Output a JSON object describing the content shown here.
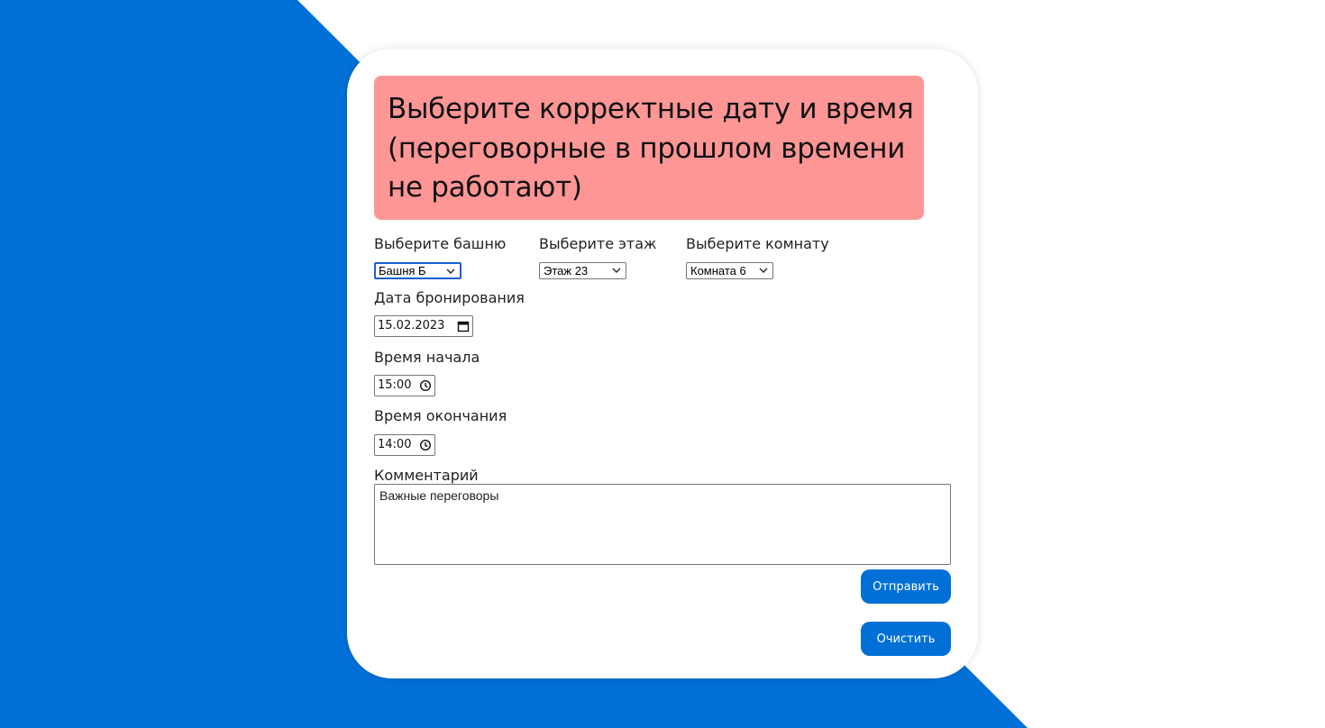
{
  "colors": {
    "accent": "#0170d6",
    "error_bg": "#ff9696",
    "background_shape": "#0170d6"
  },
  "error": {
    "message": "Выберите корректные дату и время (переговорные в прошлом времени не работают)"
  },
  "tower": {
    "label": "Выберите башню",
    "value": "Башня Б"
  },
  "floor": {
    "label": "Выберите этаж",
    "value": "Этаж 23"
  },
  "room": {
    "label": "Выберите комнату",
    "value": "Комната 6"
  },
  "date": {
    "label": "Дата бронирования",
    "value": "15.02.2023"
  },
  "start_time": {
    "label": "Время начала",
    "value": "15:00"
  },
  "end_time": {
    "label": "Время окончания",
    "value": "14:00"
  },
  "comment": {
    "label": "Комментарий",
    "value": "Важные переговоры"
  },
  "buttons": {
    "submit": "Отправить",
    "clear": "Очистить"
  }
}
